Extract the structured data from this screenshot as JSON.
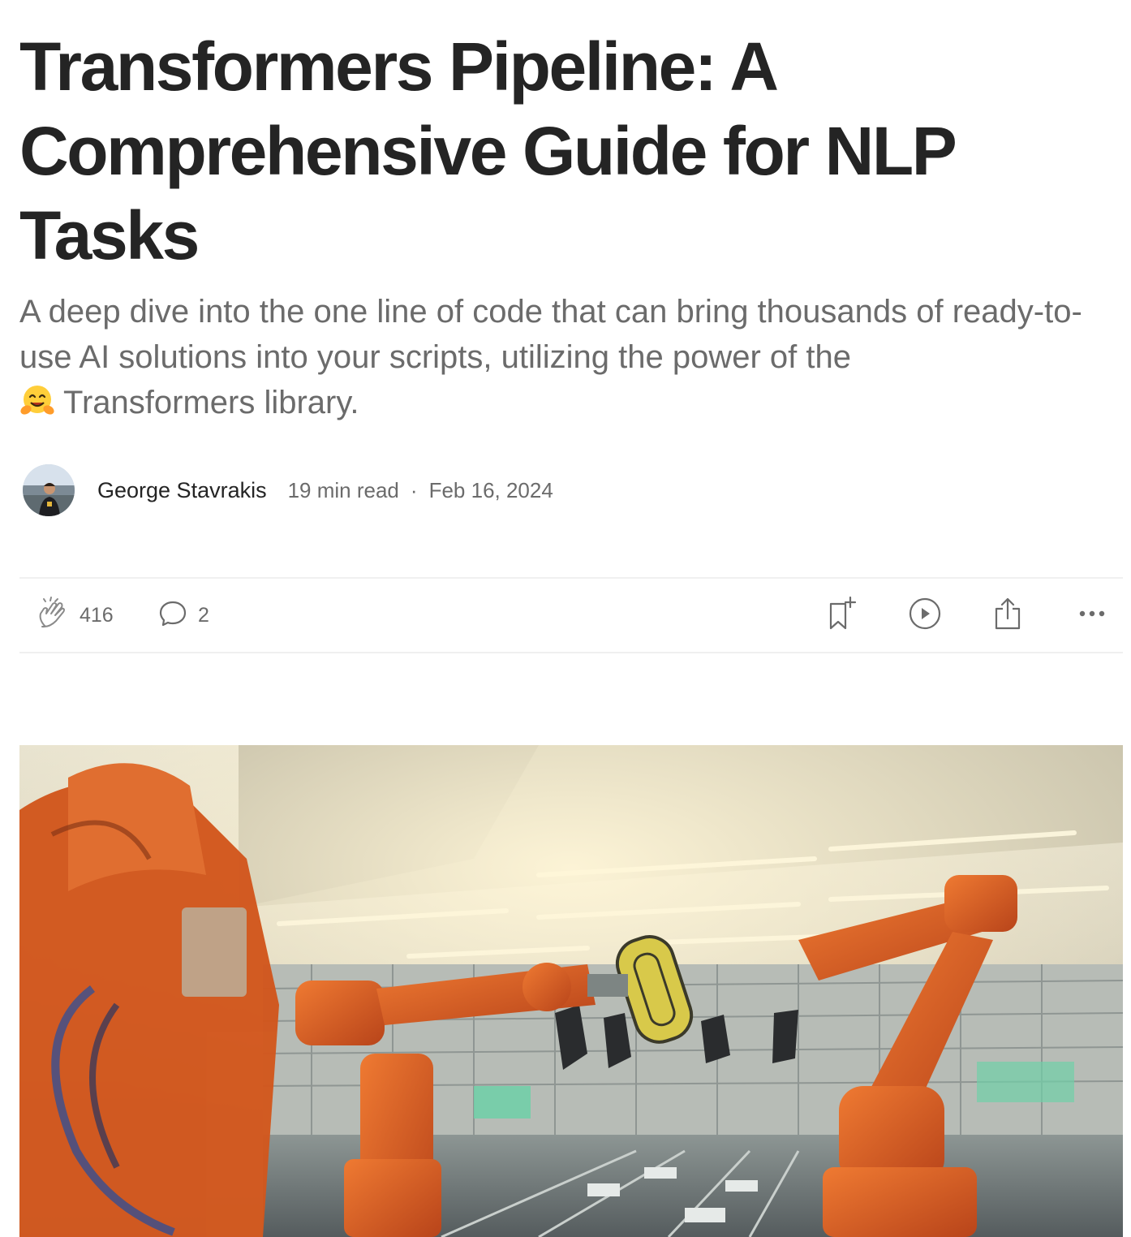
{
  "article": {
    "title": "Transformers Pipeline: A Comprehensive Guide for NLP Tasks",
    "subtitle_text": "A deep dive into the one line of code that can bring thousands of ready-to-use AI solutions into your scripts, utilizing the power of the",
    "subtitle_emoji": "hugging-face-emoji",
    "subtitle_tail": "Transformers library."
  },
  "byline": {
    "author": "George Stavrakis",
    "read_time": "19 min read",
    "separator": "·",
    "date": "Feb 16, 2024"
  },
  "actions": {
    "claps": "416",
    "responses": "2",
    "icons": [
      "clap-icon",
      "comment-icon",
      "bookmark-add-icon",
      "play-icon",
      "share-icon",
      "more-icon"
    ]
  },
  "hero_image": {
    "subject": "orange industrial robot arms in factory",
    "colors": {
      "robot": "#d2561c",
      "ceiling": "#c9c4b0",
      "light": "#fff6d8"
    }
  },
  "colors": {
    "text": "#242424",
    "muted": "#6b6b6b",
    "divider": "#f0f0f0"
  }
}
